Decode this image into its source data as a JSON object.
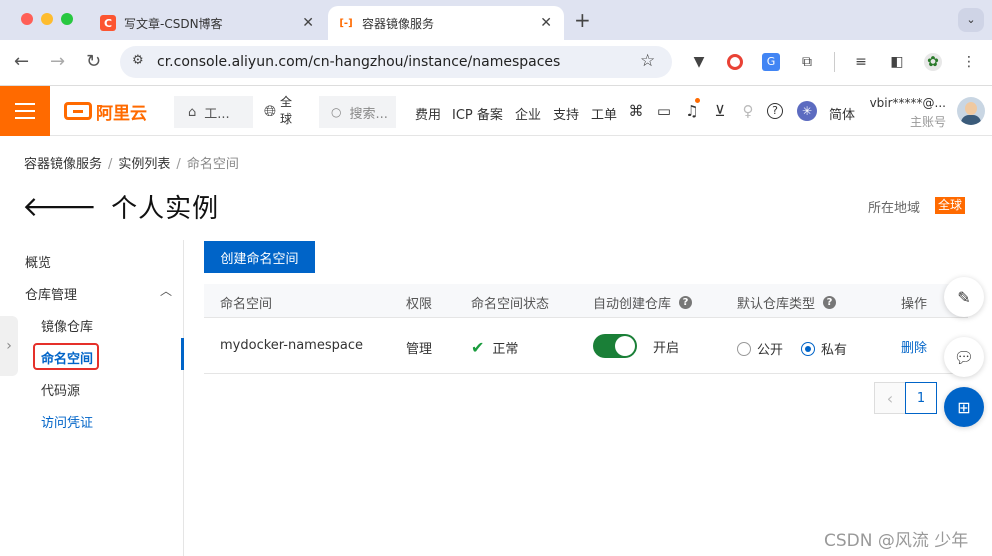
{
  "browser": {
    "tabs": [
      {
        "title": "写文章-CSDN博客",
        "favicon": "C",
        "favicon_color": "#fc5531"
      },
      {
        "title": "容器镜像服务",
        "favicon": "[-]",
        "favicon_color": "#ff6a00"
      }
    ],
    "new_tab": "+",
    "url": "cr.console.aliyun.com/cn-hangzhou/instance/namespaces"
  },
  "header": {
    "logo_text": "阿里云",
    "workbench": "工...",
    "region_line1": "全",
    "region_line2": "球",
    "search_placeholder": "搜索...",
    "nav": [
      "费用",
      "ICP 备案",
      "企业",
      "支持",
      "工单"
    ],
    "lang": "简体",
    "account_name": "vbir*****@...",
    "account_role": "主账号",
    "brand_color": "#ff6a00"
  },
  "breadcrumb": [
    "容器镜像服务",
    "实例列表",
    "命名空间"
  ],
  "page_title": "个人实例",
  "region_label": "所在地域",
  "region_value": "全球",
  "sidebar": {
    "overview": "概览",
    "repo_mgmt": "仓库管理",
    "image_repo": "镜像仓库",
    "namespace": "命名空间",
    "code_source": "代码源",
    "access_cred": "访问凭证"
  },
  "main": {
    "create_button": "创建命名空间",
    "columns": [
      "命名空间",
      "权限",
      "命名空间状态",
      "自动创建仓库",
      "默认仓库类型",
      "操作"
    ],
    "rows": [
      {
        "namespace": "mydocker-namespace",
        "permission": "管理",
        "status": "正常",
        "auto_create": "开启",
        "repo_type_public": "公开",
        "repo_type_private": "私有",
        "selected_type": "私有",
        "action": "删除"
      }
    ],
    "pagination_current": "1"
  },
  "watermark": "CSDN @风流 少年",
  "accent_color": "#0064c8"
}
